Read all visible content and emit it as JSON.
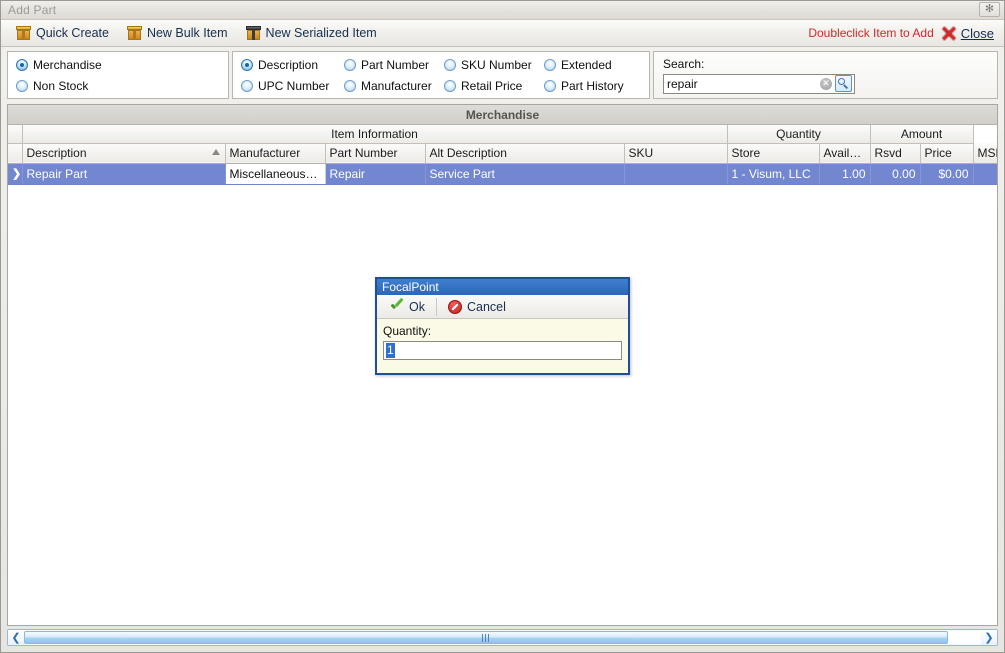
{
  "window": {
    "title": "Add Part",
    "close_glyph": "✻"
  },
  "toolbar": {
    "buttons": [
      {
        "label": "Quick Create",
        "icon": "box-icon"
      },
      {
        "label": "New Bulk Item",
        "icon": "box-icon"
      },
      {
        "label": "New Serialized Item",
        "icon": "serialized-box-icon"
      }
    ],
    "hint": "Doubleclick Item to Add",
    "close_label": "Close",
    "close_accel": "C",
    "close_icon": "red-x-icon"
  },
  "filters": {
    "item_type": [
      {
        "label": "Merchandise",
        "checked": true
      },
      {
        "label": "Non Stock",
        "checked": false
      }
    ],
    "search_fields_col1": [
      {
        "label": "Description",
        "checked": true
      },
      {
        "label": "UPC Number",
        "checked": false
      }
    ],
    "search_fields_col2": [
      {
        "label": "Part Number",
        "checked": false
      },
      {
        "label": "Manufacturer",
        "checked": false
      }
    ],
    "search_fields_col3": [
      {
        "label": "SKU Number",
        "checked": false
      },
      {
        "label": "Retail Price",
        "checked": false
      }
    ],
    "search_fields_col4": [
      {
        "label": "Extended",
        "checked": false
      },
      {
        "label": "Part History",
        "checked": false
      }
    ]
  },
  "search": {
    "label": "Search:",
    "value": "repair",
    "placeholder": "",
    "clear_icon": "clear-circle-icon",
    "go_icon": "magnifier-icon"
  },
  "grid": {
    "caption": "Merchandise",
    "band_groups": [
      {
        "label": "",
        "span": 1,
        "kind": "indicator"
      },
      {
        "label": "Item Information",
        "span": 5
      },
      {
        "label": "Quantity",
        "span": 2
      },
      {
        "label": "Amount",
        "span": 2
      }
    ],
    "columns": [
      {
        "label": "Description",
        "sorted": "asc",
        "align": "left"
      },
      {
        "label": "Manufacturer",
        "align": "left"
      },
      {
        "label": "Part Number",
        "align": "left"
      },
      {
        "label": "Alt Description",
        "align": "left"
      },
      {
        "label": "SKU",
        "align": "left"
      },
      {
        "label": "Store",
        "align": "left"
      },
      {
        "label": "Availa...",
        "align": "right"
      },
      {
        "label": "Rsvd",
        "align": "right"
      },
      {
        "label": "Price",
        "align": "right"
      },
      {
        "label": "MSR",
        "align": "right"
      }
    ],
    "rows": [
      {
        "indicator": "❯",
        "selected": true,
        "cells": [
          {
            "value": "Repair Part",
            "style": "selected"
          },
          {
            "value": "Miscellaneous In ...",
            "style": "white"
          },
          {
            "value": "Repair",
            "style": "selected"
          },
          {
            "value": "Service Part",
            "style": "selected"
          },
          {
            "value": "",
            "style": "selected"
          },
          {
            "value": "1 - Visum, LLC",
            "style": "selected"
          },
          {
            "value": "1.00",
            "style": "selected-num"
          },
          {
            "value": "0.00",
            "style": "selected-num"
          },
          {
            "value": "$0.00",
            "style": "selected-num"
          },
          {
            "value": "$",
            "style": "selected-num"
          }
        ]
      }
    ]
  },
  "scrollbar": {
    "left_arrow": "❮",
    "right_arrow": "❯",
    "thumb_grip": "grip-icon"
  },
  "dialog": {
    "title": "FocalPoint",
    "ok_label": "Ok",
    "ok_icon": "green-check-icon",
    "cancel_label": "Cancel",
    "cancel_icon": "red-deny-icon",
    "quantity_label": "Quantity:",
    "quantity_value": "1",
    "quantity_selected": true
  },
  "colors": {
    "selection_blue": "#7287CF",
    "dialog_border": "#1F4E9C",
    "dialog_title": "#2D66B8",
    "dialog_body": "#FBFAE6",
    "hint_red": "#CD2C2C",
    "link_blue": "#12304F",
    "window_chrome": "#E7E5E0"
  }
}
